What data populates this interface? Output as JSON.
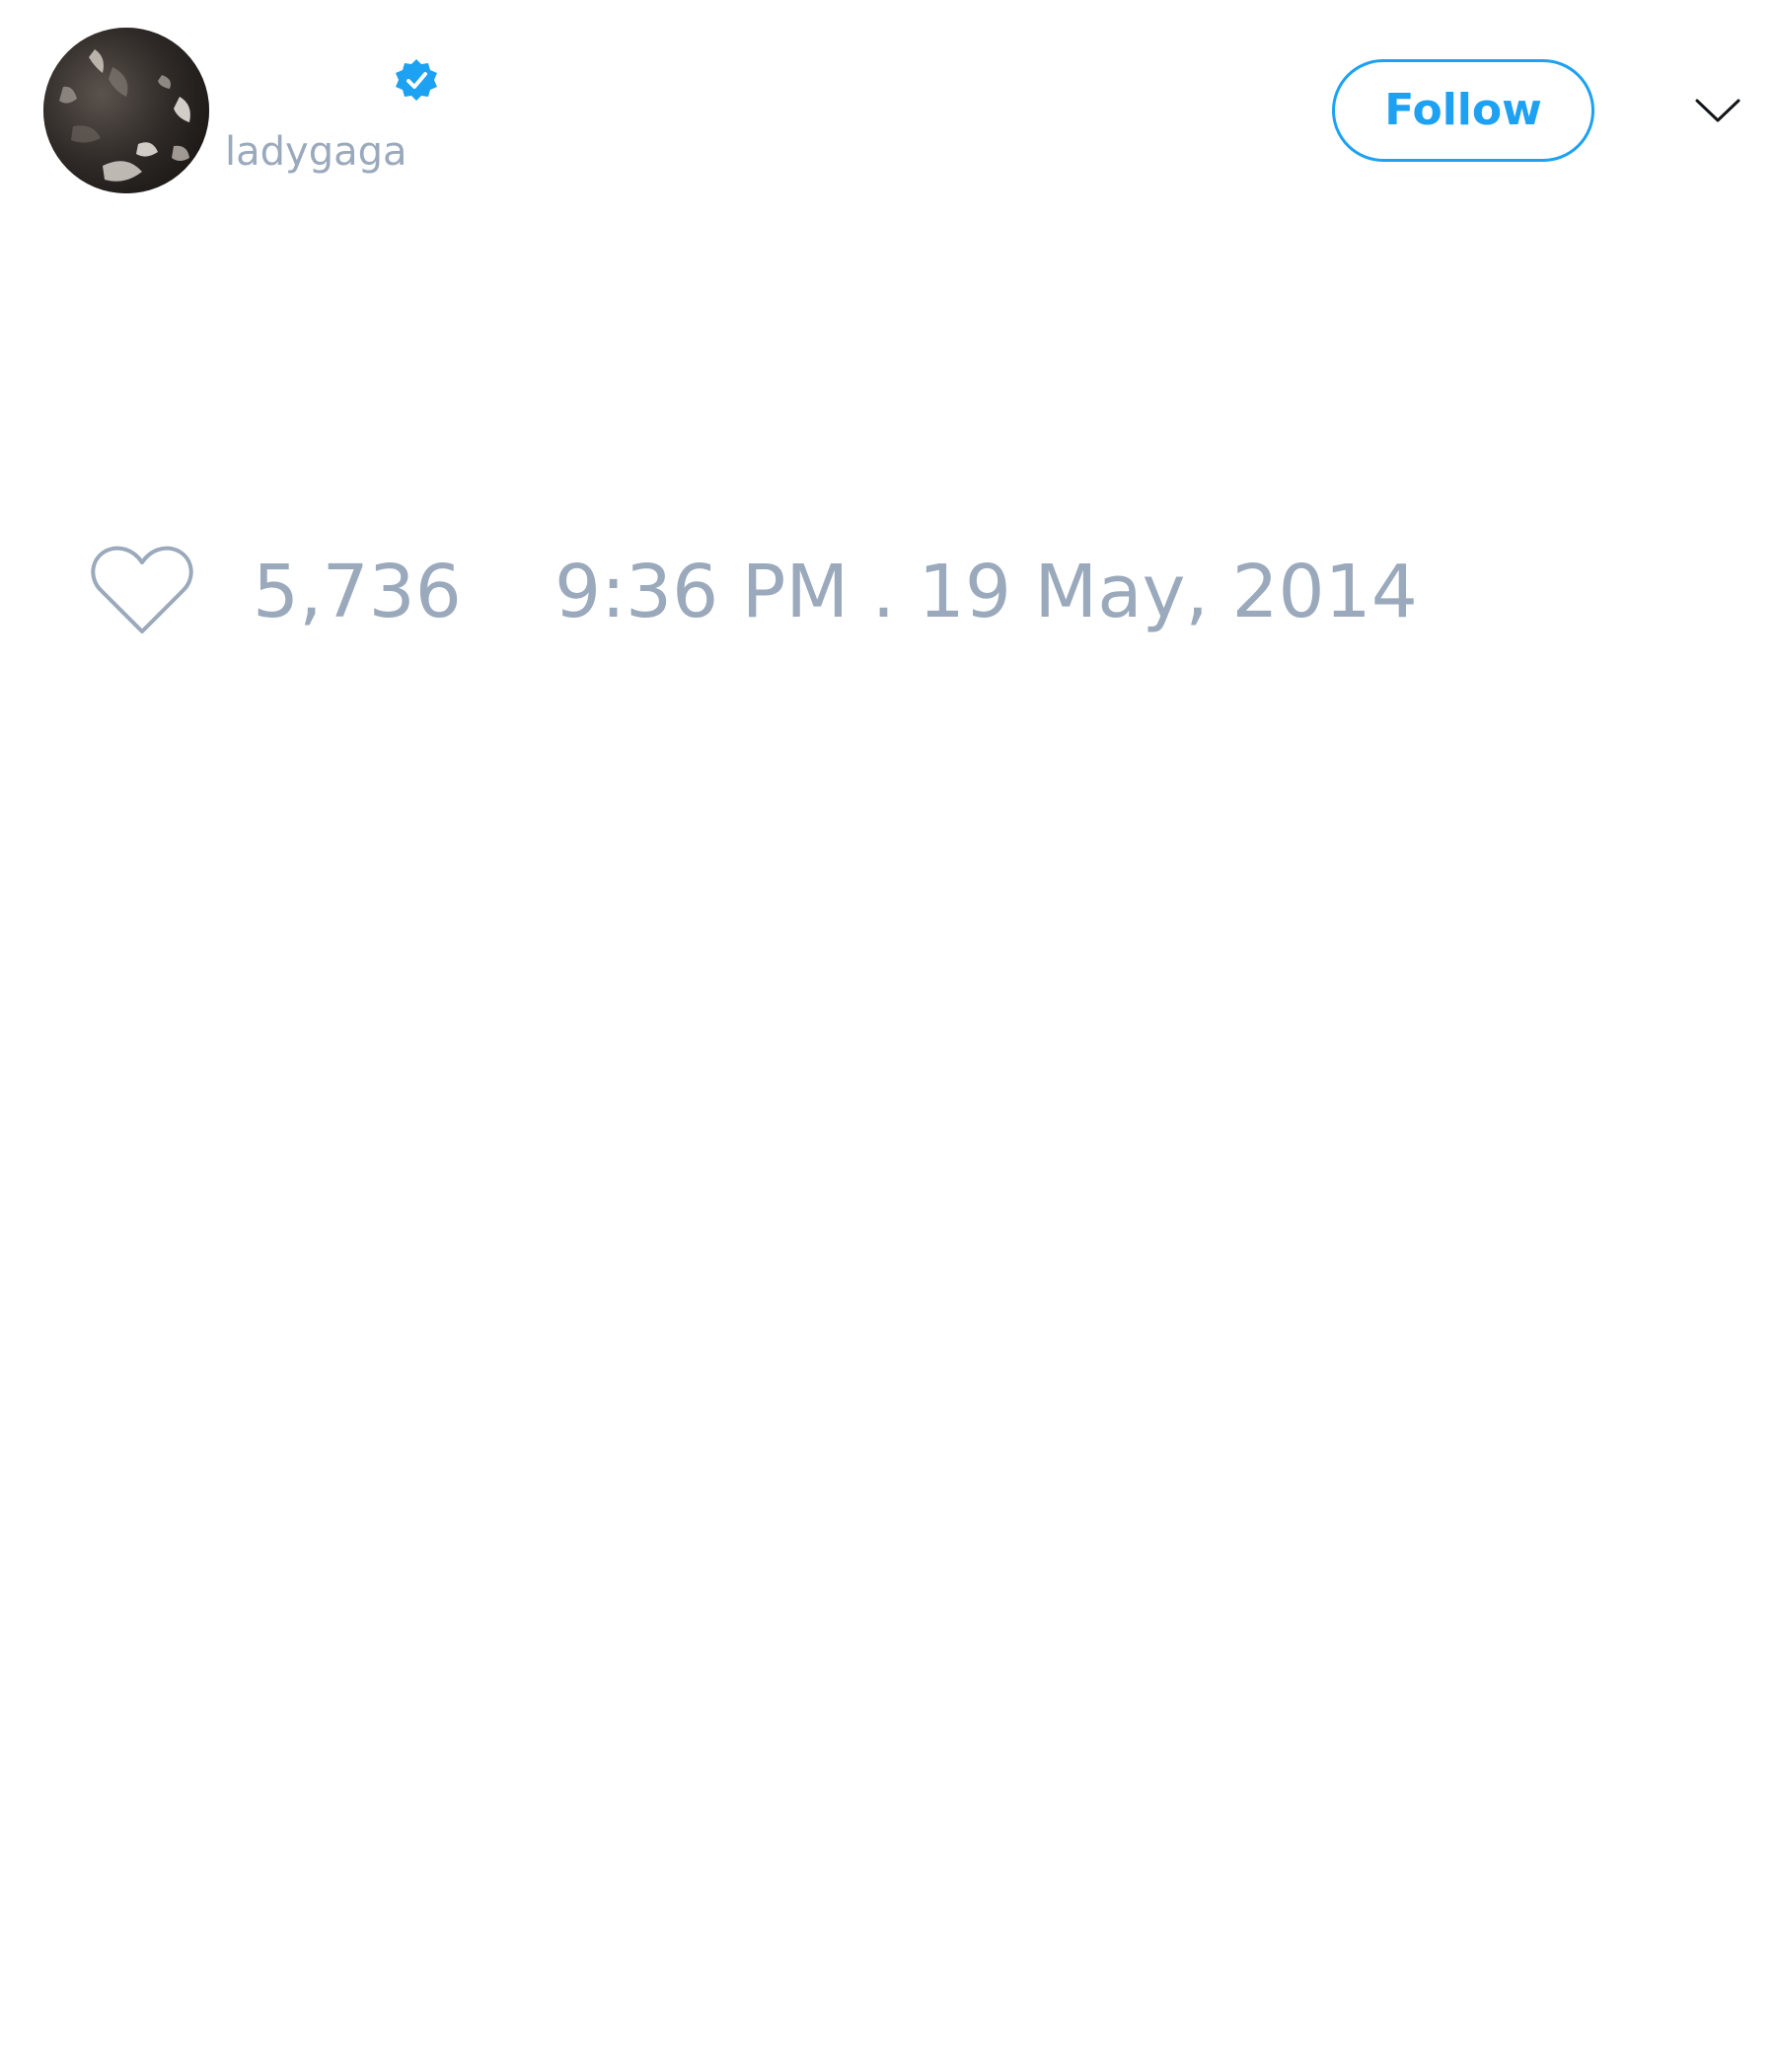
{
  "tweet": {
    "author": {
      "handle": "ladygaga",
      "verified": true,
      "avatar_icon": "user-avatar-photo"
    },
    "follow_button_label": "Follow",
    "menu_icon": "chevron-down-icon",
    "like_icon": "heart-icon",
    "like_count": "5,736",
    "timestamp": "9:36 PM . 19 May, 2014"
  },
  "colors": {
    "accent": "#1da1f2",
    "muted_text": "#9aa9bb",
    "background": "#ffffff"
  }
}
